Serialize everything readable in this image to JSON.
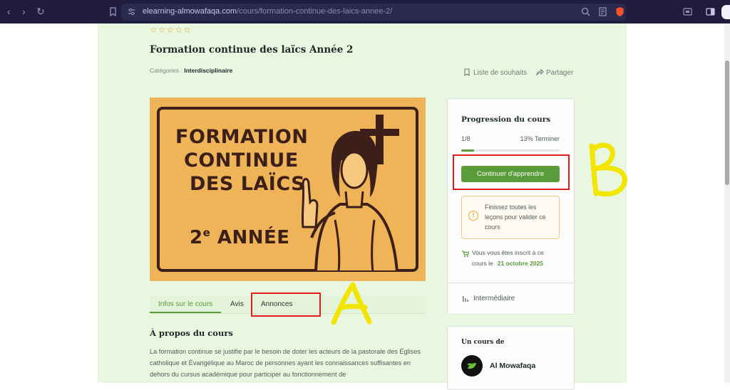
{
  "browser": {
    "url_domain": "elearning-almowafaqa.com",
    "url_path": "/cours/formation-continue-des-laics-annee-2/"
  },
  "course": {
    "stars": "☆☆☆☆☆",
    "title": "Formation continue des laïcs Année 2",
    "category_label": "Catégories :",
    "category_value": "Interdisciplinaire",
    "wishlist_label": "Liste de souhaits",
    "share_label": "Partager"
  },
  "thumbnail": {
    "line1": "FORMATION",
    "line2": "CONTINUE",
    "line3": "DES LAÏCS",
    "year_num": "2",
    "year_sup": "e",
    "year_word": "ANNÉE"
  },
  "tabs": [
    {
      "label": "Infos sur le cours",
      "active": true
    },
    {
      "label": "Avis",
      "active": false
    },
    {
      "label": "Annonces",
      "active": false
    }
  ],
  "about": {
    "heading": "À propos du cours",
    "text": "La formation continue se justifie par le besoin de doter les acteurs de la pastorale des Églises catholique et Évangélique au Maroc de personnes ayant les connaissances suffisantes en dehors du cursus académique pour participer au fonctionnement de"
  },
  "progress_card": {
    "heading": "Progression du cours",
    "count": "1/8",
    "percent_text": "13% Terminer",
    "progress_fraction": 0.13,
    "continue_button": "Continuer d'apprendre",
    "warning_text": "Finissez toutes les leçons pour valider ce cours",
    "enrolled_line1": "Vous vous êtes inscrit à ce",
    "enrolled_line2": "cours le",
    "enrolled_date": "21 octobre 2025",
    "level": "Intermédiaire"
  },
  "author_card": {
    "heading": "Un cours de",
    "name": "Al Mowafaqa"
  },
  "annotations": {
    "label_a": "A",
    "label_b": "B",
    "highlight_color": "#e01e1e",
    "marker_color": "#f2e600"
  },
  "colors": {
    "accent": "#5a9c3a",
    "page_background": "#e9f7e1",
    "thumbnail_background": "#f0b458"
  }
}
